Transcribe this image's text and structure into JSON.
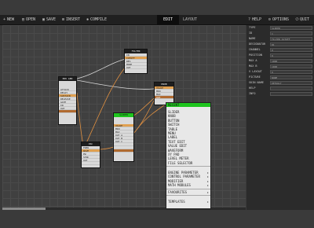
{
  "toolbar": {
    "left": [
      {
        "label": "NEW",
        "icon": "new-file-icon",
        "glyph": "+"
      },
      {
        "label": "OPEN",
        "icon": "folder-icon",
        "glyph": "▤"
      },
      {
        "label": "SAVE",
        "icon": "save-icon",
        "glyph": "▣"
      },
      {
        "label": "INSERT",
        "icon": "insert-icon",
        "glyph": "⊞"
      },
      {
        "label": "COMPILE",
        "icon": "compile-icon",
        "glyph": "✱"
      }
    ],
    "tabs": [
      {
        "label": "EDIT",
        "active": true
      },
      {
        "label": "LAYOUT",
        "active": false
      }
    ],
    "right": [
      {
        "label": "HELP",
        "icon": "help-icon",
        "glyph": "?"
      },
      {
        "label": "OPTIONS",
        "icon": "options-icon",
        "glyph": "⚙"
      },
      {
        "label": "QUIT",
        "icon": "quit-icon",
        "glyph": "⏻"
      }
    ]
  },
  "properties": [
    {
      "label": "TYPE",
      "value": "SLIDER"
    },
    {
      "label": "ID",
      "value": "1"
    },
    {
      "label": "NAME",
      "value": "FILTER CUTOFF"
    },
    {
      "label": "DESIGNATOR",
      "value": "R1"
    },
    {
      "label": "CHANNEL",
      "value": "0"
    },
    {
      "label": "POSITION",
      "value": "0"
    },
    {
      "label": "MAX A",
      "value": "1000"
    },
    {
      "label": "MAX B",
      "value": "1000"
    },
    {
      "label": "V LAYOUT",
      "value": "0"
    },
    {
      "label": "PICTURE",
      "value": "NONE"
    },
    {
      "label": "SKIN NAME",
      "value": "DEFAULT"
    },
    {
      "label": "HELP",
      "value": ""
    },
    {
      "label": "INFO",
      "value": ""
    }
  ],
  "nodes": {
    "node1": {
      "title": "ENV GEN",
      "rows": [
        "ATTACK",
        "DECAY",
        "SUSTAIN",
        "RELEASE",
        "GATE",
        "IN",
        "OUT"
      ],
      "sel": 2
    },
    "node2": {
      "title": "FILTER",
      "rows": [
        "IN",
        "CUTOFF",
        "RES",
        "MODE",
        "OUT"
      ],
      "sel": 1
    },
    "node3": {
      "title": "KNOB",
      "rows": [
        "VALUE",
        "MIN",
        "MAX",
        "OUT"
      ],
      "sel": 0
    },
    "node4": {
      "title": "SLIDER",
      "rows": [
        "VALUE",
        "MIN",
        "MAX",
        "OUT A",
        "OUT B",
        "OUT C"
      ],
      "sel": 0
    },
    "node5": {
      "title": "OSC",
      "rows": [
        "FREQ",
        "WAVE",
        "PW",
        "SYNC",
        "OUT"
      ],
      "sel": 1
    },
    "node6": {
      "title": "MIXER",
      "rows": [
        "IN 1",
        "IN 2",
        "IN 3",
        "LEVEL",
        "OUT"
      ],
      "sel": 4
    }
  },
  "context_menu": {
    "header": "RECENT",
    "group1": [
      "SLIDER",
      "KNOB",
      "BUTTON",
      "SWITCH",
      "TABLE",
      "MENU",
      "LABEL",
      "TEXT EDIT",
      "VALUE EDIT",
      "WAVEFORM",
      "XY PAD",
      "LEVEL METER",
      "FILE SELECTOR"
    ],
    "group2": [
      "ENGINE PARAMETER",
      "CONTROL PARAMETER",
      "MODIFIER",
      "MATH MODULES"
    ],
    "group3": [
      "FAVOURITES"
    ],
    "group4": [
      "TEMPLATES"
    ]
  }
}
